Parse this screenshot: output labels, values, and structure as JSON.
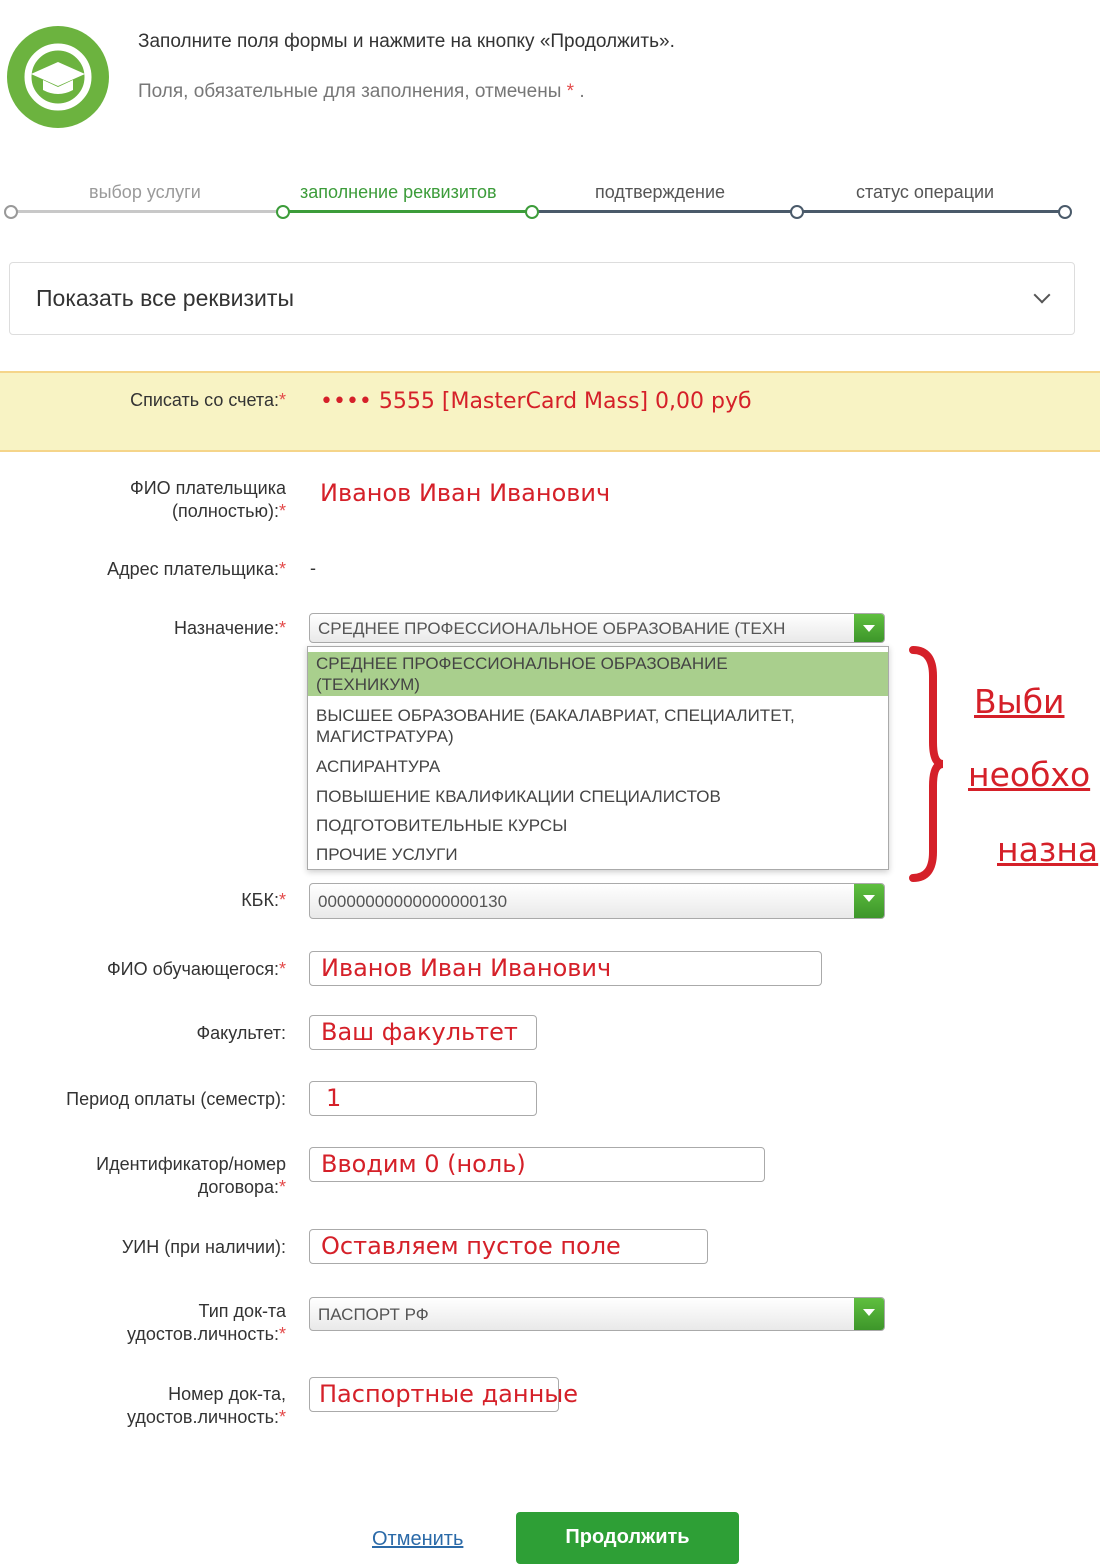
{
  "header": {
    "line1": "Заполните поля формы и нажмите на кнопку «Продолжить».",
    "line2": "Поля, обязательные для заполнения, отмечены",
    "line2_asterisk": "*",
    "line2_end": "."
  },
  "steps": [
    {
      "label": "выбор услуги",
      "state": "done"
    },
    {
      "label": "заполнение реквизитов",
      "state": "active"
    },
    {
      "label": "подтверждение",
      "state": "next"
    },
    {
      "label": "статус операции",
      "state": "next"
    }
  ],
  "details_toggle": {
    "label": "Показать все реквизиты"
  },
  "form": {
    "account": {
      "label": "Списать со счета:",
      "value": "•••• 5555 [MasterCard Mass] 0,00 руб"
    },
    "payer_name": {
      "label1": "ФИО плательщика",
      "label2": "(полностью):",
      "value": "Иванов Иван Иванович"
    },
    "payer_address": {
      "label": "Адрес плательщика:",
      "value": "-"
    },
    "purpose": {
      "label": "Назначение:",
      "selected": "СРЕДНЕЕ ПРОФЕССИОНАЛЬНОЕ ОБРАЗОВАНИЕ (ТЕХН",
      "options": [
        [
          "СРЕДНЕЕ ПРОФЕССИОНАЛЬНОЕ ОБРАЗОВАНИЕ",
          "(ТЕХНИКУМ)"
        ],
        [
          "ВЫСШЕЕ ОБРАЗОВАНИЕ (БАКАЛАВРИАТ, СПЕЦИАЛИТЕТ,",
          "МАГИСТРАТУРА)"
        ],
        [
          "АСПИРАНТУРА"
        ],
        [
          "ПОВЫШЕНИЕ КВАЛИФИКАЦИИ СПЕЦИАЛИСТОВ"
        ],
        [
          "ПОДГОТОВИТЕЛЬНЫЕ КУРСЫ"
        ],
        [
          "ПРОЧИЕ УСЛУГИ"
        ]
      ]
    },
    "kbk": {
      "label": "КБК:",
      "value": "00000000000000000130"
    },
    "student_name": {
      "label": "ФИО обучающегося:",
      "value": "Иванов Иван Иванович"
    },
    "faculty": {
      "label": "Факультет:",
      "value": "Ваш факультет"
    },
    "period": {
      "label": "Период оплаты (семестр):",
      "value": "1"
    },
    "contract": {
      "label1": "Идентификатор/номер",
      "label2": "договора:",
      "value": "Вводим 0 (ноль)"
    },
    "uin": {
      "label": "УИН (при наличии):",
      "value": "Оставляем пустое поле"
    },
    "doc_type": {
      "label1": "Тип док-та",
      "label2": "удостов.личность:",
      "value": "ПАСПОРТ РФ"
    },
    "doc_number": {
      "label1": "Номер док-та,",
      "label2": "удостов.личность:",
      "value": "Паспортные данные"
    },
    "required_mark": "*"
  },
  "annotation": {
    "lines": [
      "Выби",
      "необхо",
      "назна"
    ]
  },
  "actions": {
    "cancel": "Отменить",
    "continue": "Продолжить"
  },
  "colors": {
    "brand_green": "#6cb33f",
    "annotation_red": "#d52029",
    "highlight_band": "#f8f3c4"
  }
}
